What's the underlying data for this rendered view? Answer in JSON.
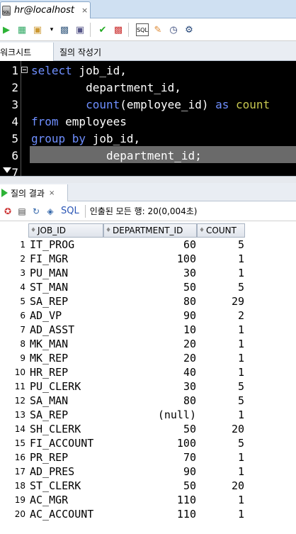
{
  "connection_tab": {
    "title": "hr@localhost",
    "close": "×",
    "db_badge": "SQL"
  },
  "subtabs": {
    "worksheet": "워크시트",
    "query_builder": "질의 작성기"
  },
  "editor": {
    "line_numbers": [
      "1",
      "2",
      "3",
      "4",
      "5",
      "6",
      "7"
    ],
    "lines": [
      [
        {
          "t": "select",
          "c": "kw"
        },
        {
          "t": " job_id,",
          "c": "txt"
        }
      ],
      [
        {
          "t": "        department_id,",
          "c": "txt"
        }
      ],
      [
        {
          "t": "        ",
          "c": "txt"
        },
        {
          "t": "count",
          "c": "fn"
        },
        {
          "t": "(employee_id) ",
          "c": "txt"
        },
        {
          "t": "as",
          "c": "kw"
        },
        {
          "t": " ",
          "c": "txt"
        },
        {
          "t": "count",
          "c": "cnt"
        }
      ],
      [
        {
          "t": "from",
          "c": "kw"
        },
        {
          "t": " employees",
          "c": "txt"
        }
      ],
      [
        {
          "t": "group by",
          "c": "kw"
        },
        {
          "t": " job_id,",
          "c": "txt"
        }
      ],
      [
        {
          "t": "           department_id;",
          "c": "txt"
        }
      ],
      [
        {
          "t": "",
          "c": "txt"
        }
      ]
    ]
  },
  "result_tab": {
    "label": "질의 결과",
    "close": "×"
  },
  "result_toolbar": {
    "sql_label": "SQL",
    "fetch_message": "인출된 모든 행: 20(0,004초)"
  },
  "grid": {
    "columns": [
      "JOB_ID",
      "DEPARTMENT_ID",
      "COUNT"
    ],
    "rows": [
      [
        "1",
        "IT_PROG",
        "60",
        "5"
      ],
      [
        "2",
        "FI_MGR",
        "100",
        "1"
      ],
      [
        "3",
        "PU_MAN",
        "30",
        "1"
      ],
      [
        "4",
        "ST_MAN",
        "50",
        "5"
      ],
      [
        "5",
        "SA_REP",
        "80",
        "29"
      ],
      [
        "6",
        "AD_VP",
        "90",
        "2"
      ],
      [
        "7",
        "AD_ASST",
        "10",
        "1"
      ],
      [
        "8",
        "MK_MAN",
        "20",
        "1"
      ],
      [
        "9",
        "MK_REP",
        "20",
        "1"
      ],
      [
        "10",
        "HR_REP",
        "40",
        "1"
      ],
      [
        "11",
        "PU_CLERK",
        "30",
        "5"
      ],
      [
        "12",
        "SA_MAN",
        "80",
        "5"
      ],
      [
        "13",
        "SA_REP",
        "(null)",
        "1"
      ],
      [
        "14",
        "SH_CLERK",
        "50",
        "20"
      ],
      [
        "15",
        "FI_ACCOUNT",
        "100",
        "5"
      ],
      [
        "16",
        "PR_REP",
        "70",
        "1"
      ],
      [
        "17",
        "AD_PRES",
        "90",
        "1"
      ],
      [
        "18",
        "ST_CLERK",
        "50",
        "20"
      ],
      [
        "19",
        "AC_MGR",
        "110",
        "1"
      ],
      [
        "20",
        "AC_ACCOUNT",
        "110",
        "1"
      ]
    ]
  },
  "colors": {
    "editor_bg": "#000000",
    "keyword": "#6f8fff",
    "alias": "#c8c850",
    "highlight": "#6a6a6a"
  }
}
